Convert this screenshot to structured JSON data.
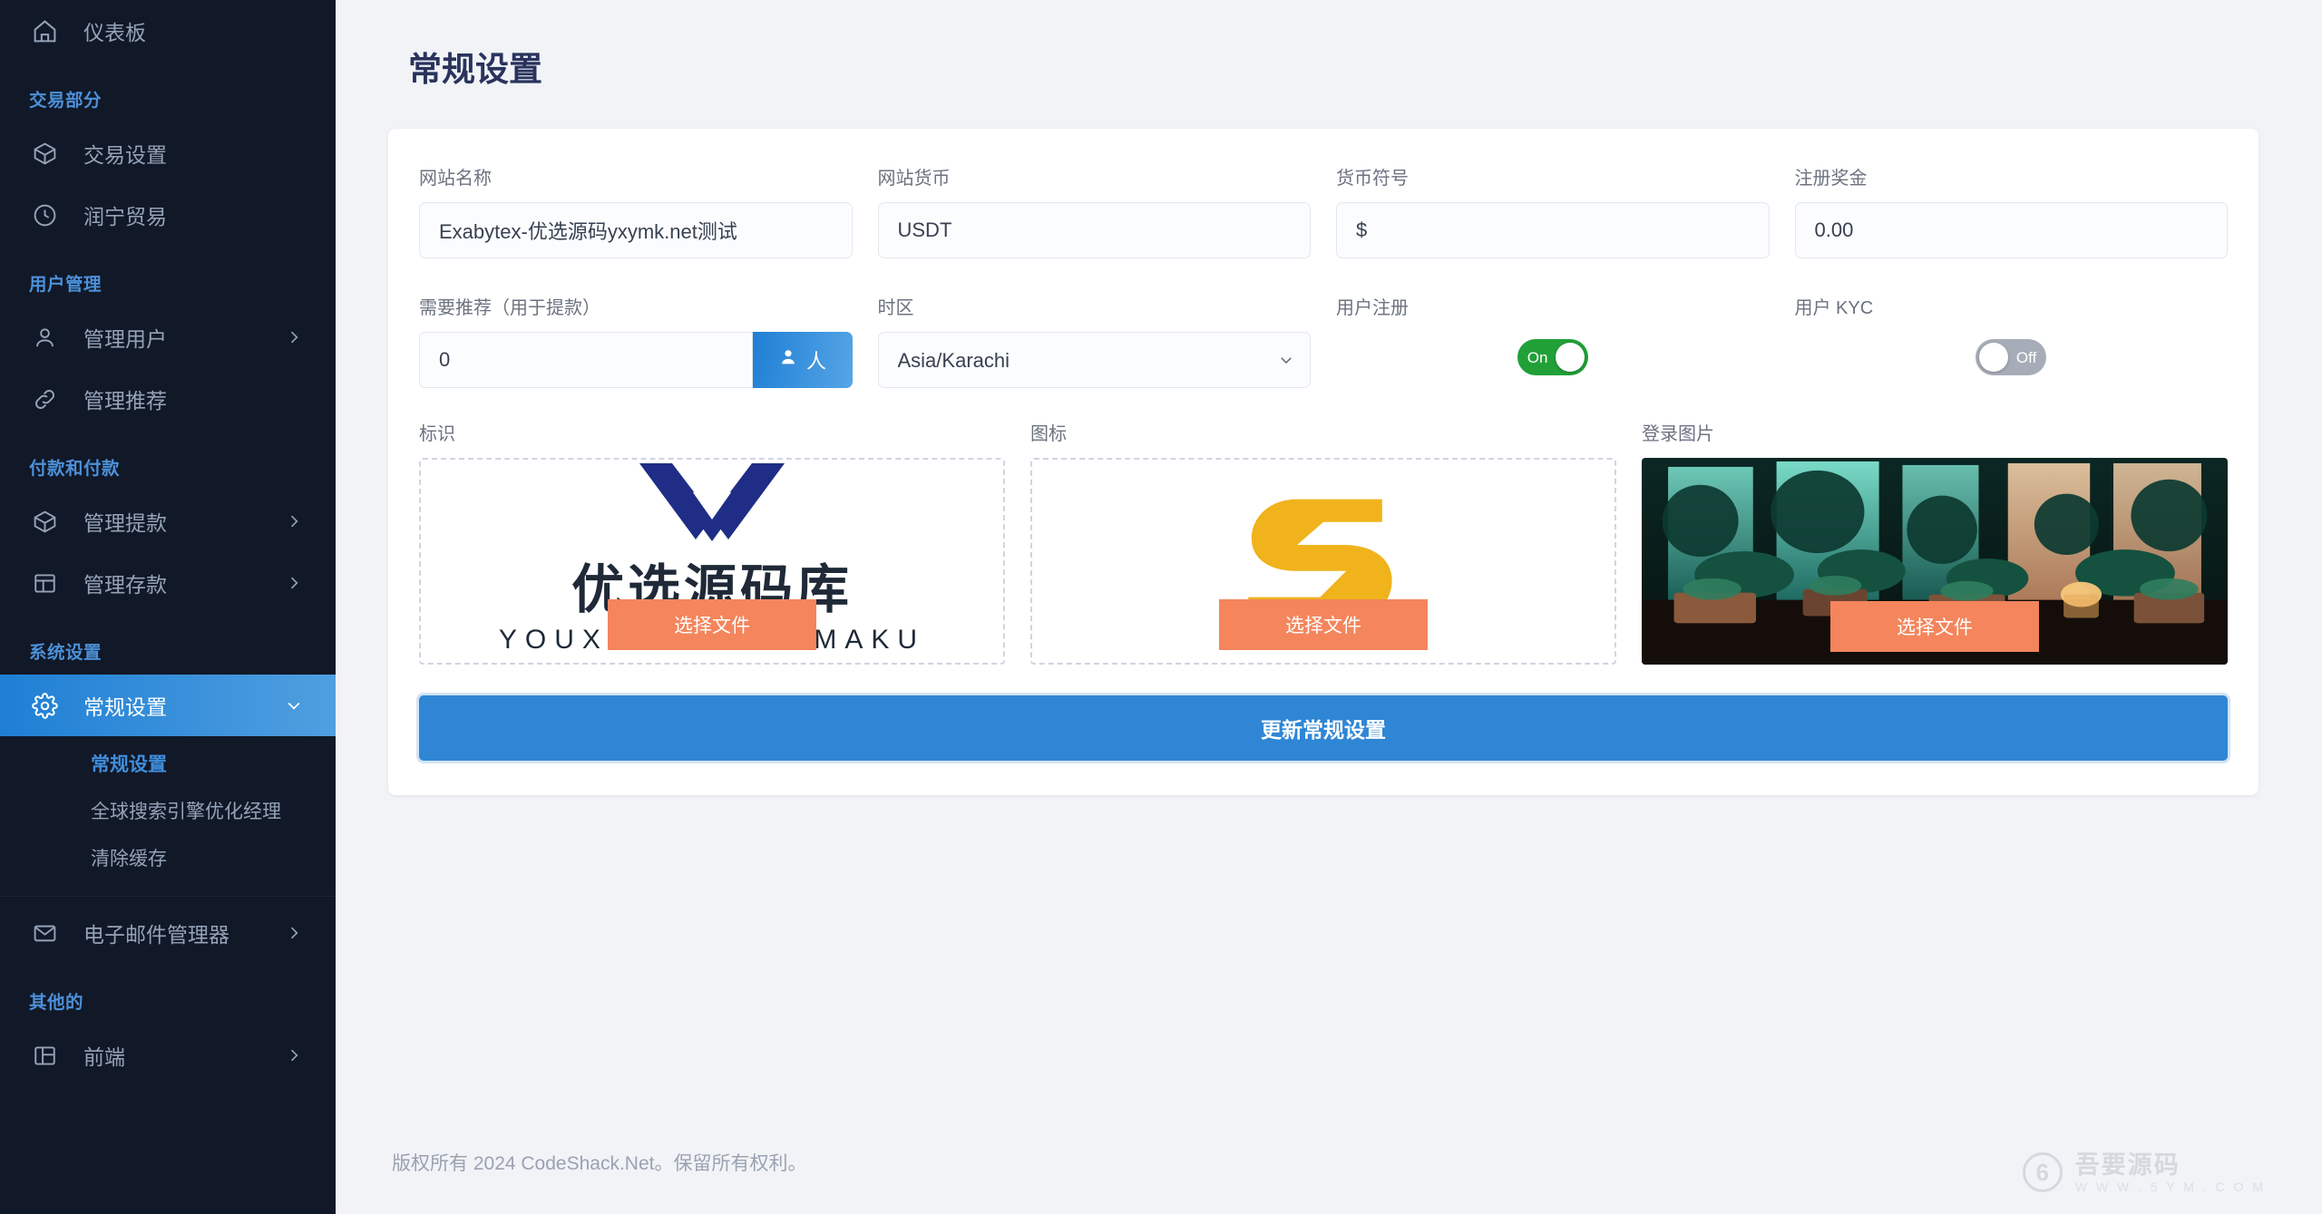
{
  "sidebar": {
    "top_item": {
      "label": "仪表板",
      "icon": "home-icon"
    },
    "sections": [
      {
        "title": "交易部分",
        "items": [
          {
            "label": "交易设置",
            "icon": "box-icon",
            "caret": false
          },
          {
            "label": "润宁贸易",
            "icon": "clock-icon",
            "caret": false
          }
        ]
      },
      {
        "title": "用户管理",
        "items": [
          {
            "label": "管理用户",
            "icon": "user-icon",
            "caret": true
          },
          {
            "label": "管理推荐",
            "icon": "link-icon",
            "caret": false
          }
        ]
      },
      {
        "title": "付款和付款",
        "items": [
          {
            "label": "管理提款",
            "icon": "box-icon",
            "caret": true
          },
          {
            "label": "管理存款",
            "icon": "table-icon",
            "caret": true
          }
        ]
      },
      {
        "title": "系统设置",
        "items": [
          {
            "label": "常规设置",
            "icon": "gear-icon",
            "caret": true,
            "active": true
          },
          {
            "label": "电子邮件管理器",
            "icon": "mail-icon",
            "caret": true
          }
        ]
      },
      {
        "title": "其他的",
        "items": [
          {
            "label": "前端",
            "icon": "layout-icon",
            "caret": true
          }
        ]
      }
    ],
    "submenu": [
      {
        "label": "常规设置",
        "current": true
      },
      {
        "label": "全球搜索引擎优化经理",
        "current": false
      },
      {
        "label": "清除缓存",
        "current": false
      }
    ],
    "accent_active": "#2f86d4",
    "section_title_color": "#4c90d8"
  },
  "page": {
    "title": "常规设置"
  },
  "form": {
    "site_name": {
      "label": "网站名称",
      "value": "Exabytex-优选源码yxymk.net测试",
      "placeholder": "网站名称"
    },
    "site_currency": {
      "label": "网站货币",
      "value": "USDT",
      "placeholder": "网站货币"
    },
    "currency_symbol": {
      "label": "货币符号",
      "value": "$",
      "placeholder": "货币符号"
    },
    "signup_bonus": {
      "label": "注册奖金",
      "value": "0.00",
      "placeholder": "0.00"
    },
    "referral_needed": {
      "label": "需要推荐（用于提款）",
      "value": "0",
      "placeholder": "0",
      "addon_label": "人",
      "addon_icon": "user-icon"
    },
    "timezone": {
      "label": "时区",
      "value": "Asia/Karachi",
      "options": [
        "Asia/Karachi"
      ]
    },
    "user_registration": {
      "label": "用户注册",
      "state": "On",
      "enabled": true
    },
    "user_kyc": {
      "label": "用户 KYC",
      "state": "Off",
      "enabled": false
    }
  },
  "uploads": [
    {
      "label": "标识",
      "button": "选择文件",
      "preview": "logo",
      "logo_text_cn": "优选源码库",
      "logo_text_en": "YOUXUAN YUANMAKU"
    },
    {
      "label": "图标",
      "button": "选择文件",
      "preview": "icon"
    },
    {
      "label": "登录图片",
      "button": "选择文件",
      "preview": "photo"
    }
  ],
  "submit": {
    "label": "更新常规设置"
  },
  "footer": {
    "copyright": "版权所有 2024 CodeShack.Net。保留所有权利。",
    "watermark_mark": "6",
    "watermark_main": "吾要源码",
    "watermark_sub": "W W W . 5 Y M . C O M"
  },
  "colors": {
    "sidebar_bg": "#111827",
    "primary": "#2f86d4",
    "orange": "#f4855c",
    "green": "#21a038",
    "grey": "#a7adb8"
  }
}
